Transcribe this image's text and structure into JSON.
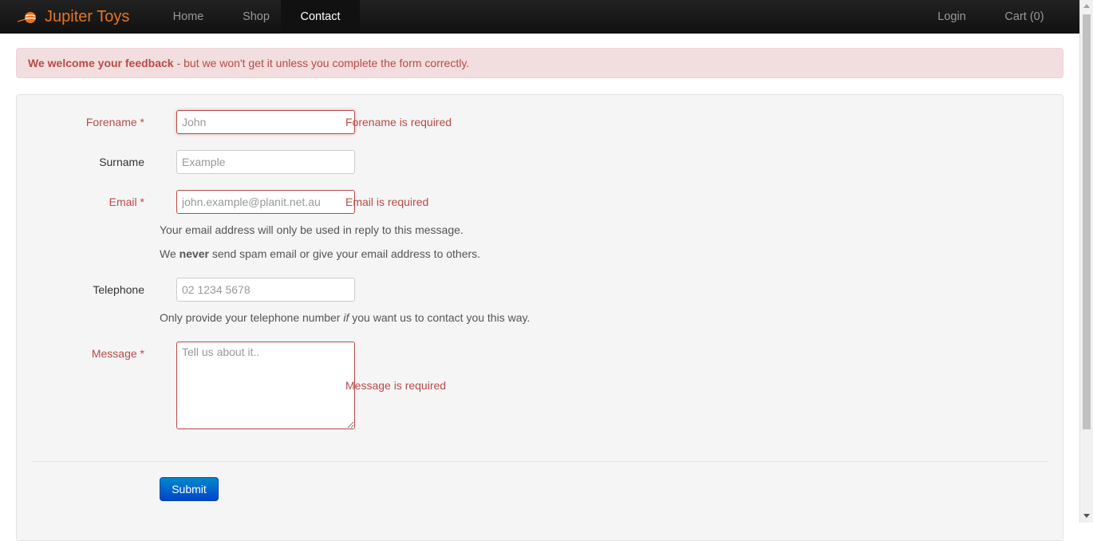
{
  "nav": {
    "brand": "Jupiter Toys",
    "items": [
      {
        "label": "Home"
      },
      {
        "label": "Shop"
      },
      {
        "label": "Contact"
      }
    ],
    "login": "Login",
    "cart": "Cart (0)"
  },
  "alert": {
    "strong": "We welcome your feedback",
    "text": "- but we won't get it unless you complete the form correctly."
  },
  "form": {
    "forename": {
      "label": "Forename *",
      "placeholder": "John",
      "value": "",
      "error": "Forename is required"
    },
    "surname": {
      "label": "Surname",
      "placeholder": "Example",
      "value": ""
    },
    "email": {
      "label": "Email *",
      "placeholder": "john.example@planit.net.au",
      "value": "",
      "error": "Email is required",
      "help1": "Your email address will only be used in reply to this message.",
      "help2_pre": "We ",
      "help2_bold": "never",
      "help2_post": " send spam email or give your email address to others."
    },
    "telephone": {
      "label": "Telephone",
      "placeholder": "02 1234 5678",
      "value": "",
      "help_pre": "Only provide your telephone number ",
      "help_em": "if",
      "help_post": " you want us to contact you this way."
    },
    "message": {
      "label": "Message *",
      "placeholder": "Tell us about it..",
      "value": "",
      "error": "Message is required"
    },
    "submit": "Submit"
  },
  "colors": {
    "brand": "#e8741e",
    "error": "#b94a48",
    "alert_bg": "#f2dede",
    "button": "#0055cc"
  }
}
